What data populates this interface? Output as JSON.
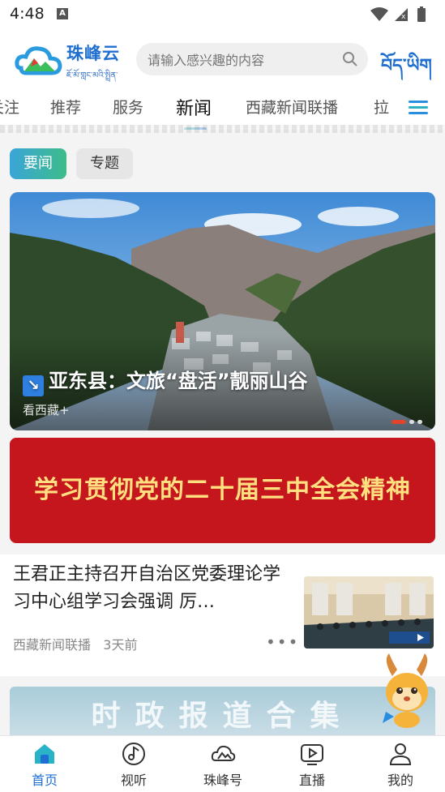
{
  "status": {
    "time": "4:48",
    "a_badge": "A"
  },
  "header": {
    "app_name": "珠峰云",
    "app_name_tibetan": "ཇོ་མོ་གླང་མའི་སྤྲིན་",
    "search_placeholder": "请输入感兴趣的内容",
    "lang_switch": "བོད་ཡིག"
  },
  "tabs": [
    {
      "label": "关注"
    },
    {
      "label": "推荐"
    },
    {
      "label": "服务"
    },
    {
      "label": "新闻",
      "active": true
    },
    {
      "label": "西藏新闻联播"
    },
    {
      "label": "拉"
    }
  ],
  "subtabs": [
    {
      "label": "要闻",
      "active": true
    },
    {
      "label": "专题"
    }
  ],
  "hero": {
    "title": "亚东县：文旅“盘活”靓丽山谷",
    "source": "看西藏+",
    "slide_index": 1,
    "slide_count": 3
  },
  "banner": {
    "text": "学习贯彻党的二十届三中全会精神"
  },
  "news": [
    {
      "title": "王君正主持召开自治区党委理论学习中心组学习会强调 厉…",
      "source": "西藏新闻联播",
      "time": "3天前"
    }
  ],
  "bottom_banner": {
    "text": "时政报道合集"
  },
  "bottom_nav": [
    {
      "label": "首页",
      "icon": "home-icon",
      "active": true
    },
    {
      "label": "视听",
      "icon": "music-note-icon"
    },
    {
      "label": "珠峰号",
      "icon": "cloud-icon"
    },
    {
      "label": "直播",
      "icon": "play-icon"
    },
    {
      "label": "我的",
      "icon": "user-icon"
    }
  ],
  "colors": {
    "brand_blue": "#1f6fd1",
    "banner_red": "#c4161c",
    "banner_text": "#ffdf80"
  }
}
